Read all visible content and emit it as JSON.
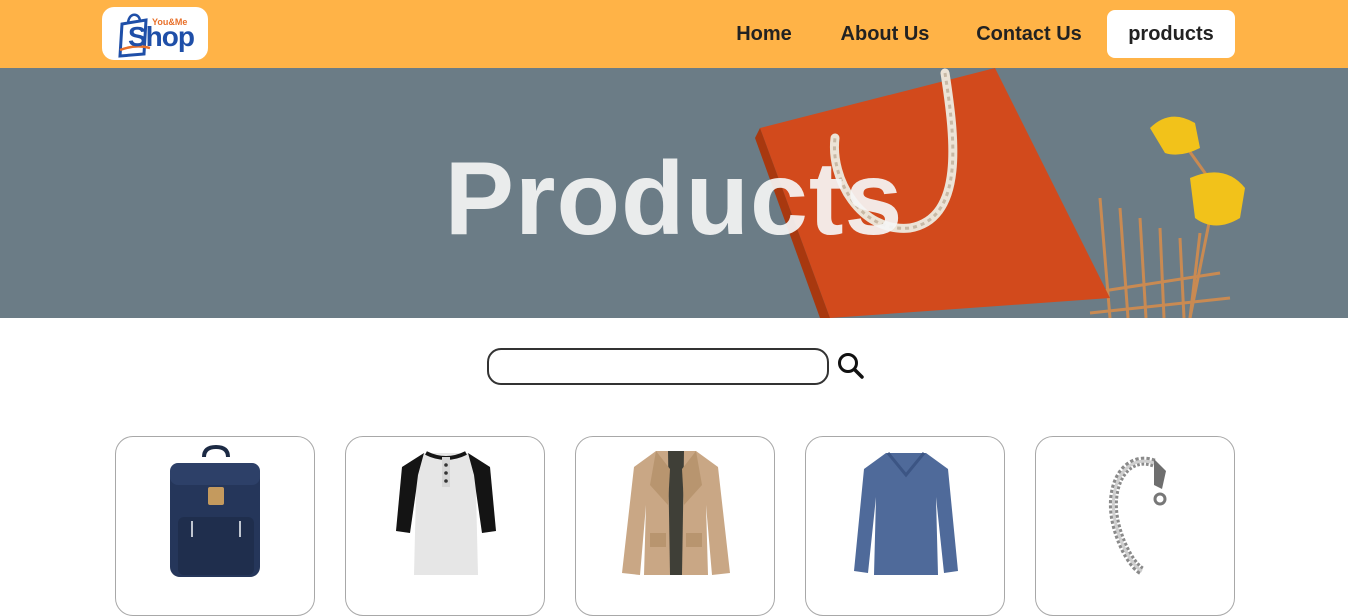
{
  "header": {
    "logo": {
      "small_text": "You&Me",
      "main_text": "Shop"
    },
    "nav": [
      {
        "label": "Home"
      },
      {
        "label": "About Us"
      },
      {
        "label": "Contact Us"
      },
      {
        "label": "products",
        "active": true
      }
    ],
    "background_color": "#FFB347"
  },
  "hero": {
    "title": "Products"
  },
  "search": {
    "value": "",
    "icon": "search-icon"
  },
  "products": [
    {
      "image": "backpack"
    },
    {
      "image": "henley-tshirt"
    },
    {
      "image": "jacket"
    },
    {
      "image": "long-sleeve-shirt"
    },
    {
      "image": "bracelet"
    }
  ]
}
